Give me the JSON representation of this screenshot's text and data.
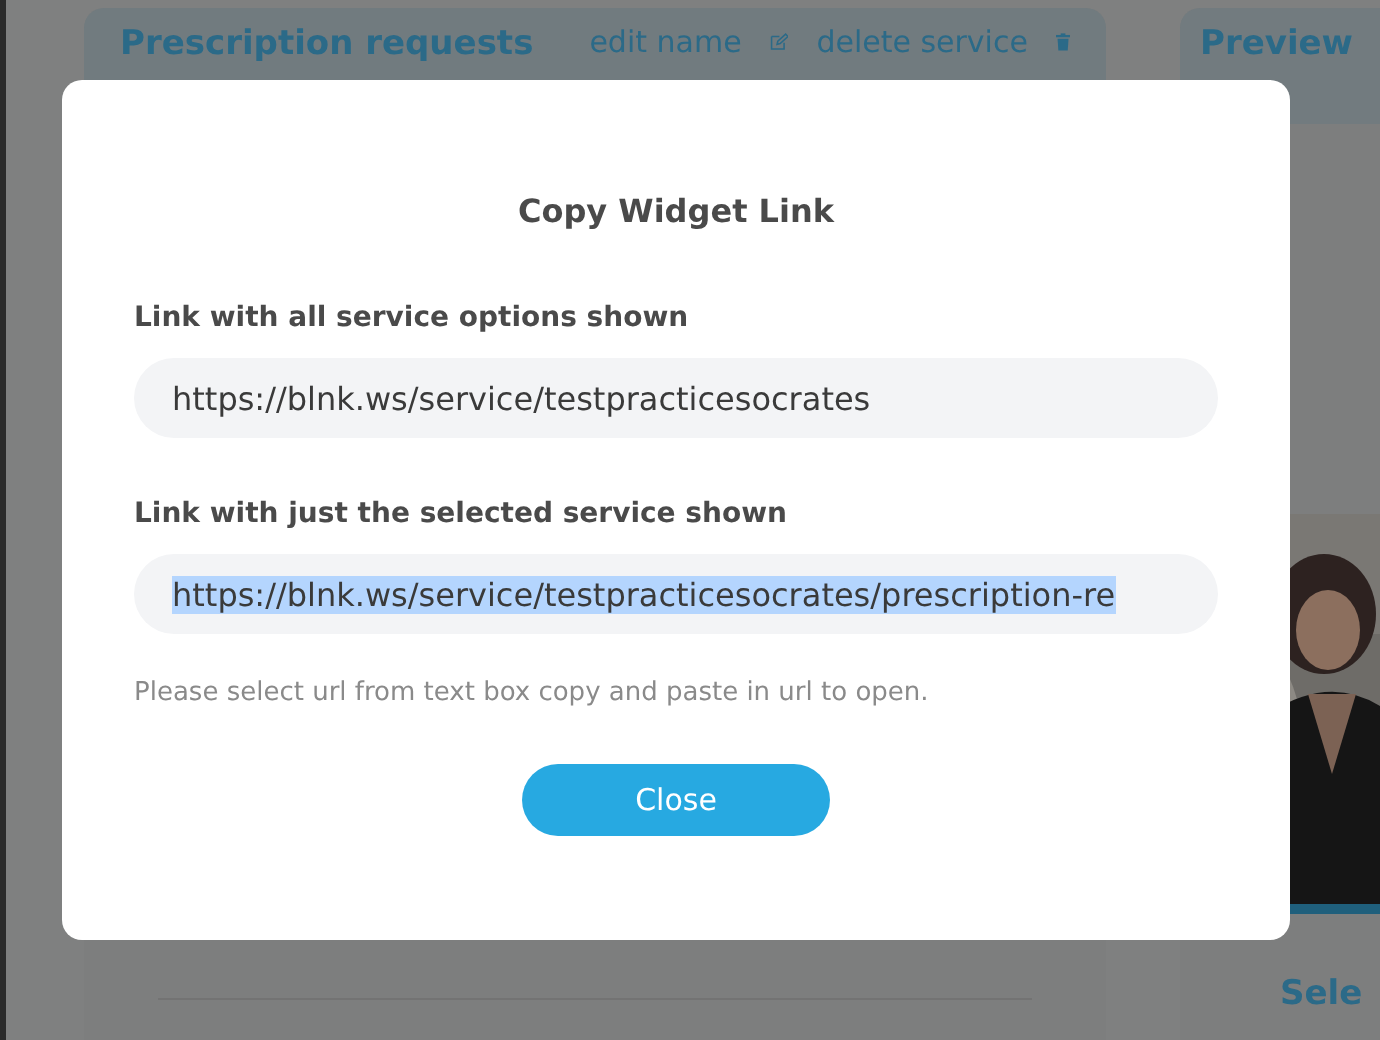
{
  "background": {
    "service_panel": {
      "title": "Prescription requests",
      "edit_label": "edit name",
      "delete_label": "delete service"
    },
    "preview_panel": {
      "title": "Preview",
      "footer_text": "Sele"
    }
  },
  "dialog": {
    "title": "Copy Widget Link",
    "fields": [
      {
        "label": "Link with all service options shown",
        "value": "https://blnk.ws/service/testpracticesocrates",
        "text_selected": false
      },
      {
        "label": "Link with just the selected service shown",
        "value": "https://blnk.ws/service/testpracticesocrates/prescription-re",
        "text_selected": true
      }
    ],
    "hint": "Please select url from text box copy and paste in url to open.",
    "buttons": [
      "Close"
    ]
  }
}
